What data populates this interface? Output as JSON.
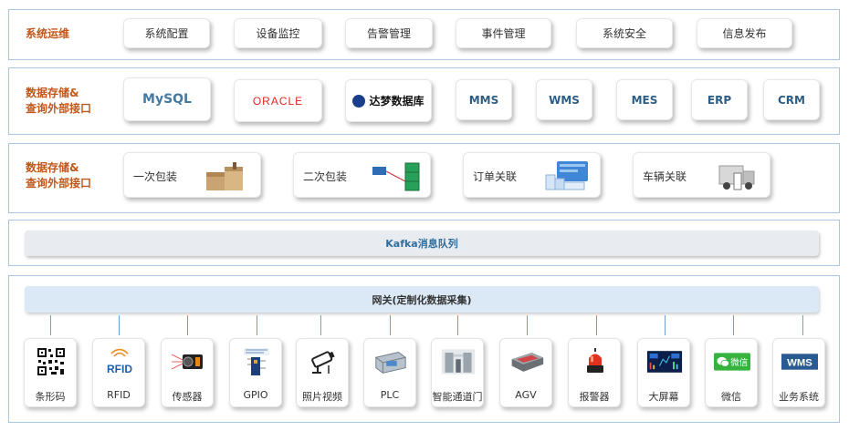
{
  "row1": {
    "label": "系统运维",
    "items": [
      "系统配置",
      "设备监控",
      "告警管理",
      "事件管理",
      "系统安全",
      "信息发布"
    ]
  },
  "row2": {
    "label": "数据存储&\n查询外部接口",
    "logos": {
      "mysql": "MySQL",
      "oracle": "ORACLE",
      "dameng": "达梦数据库"
    },
    "systems": [
      "MMS",
      "WMS",
      "MES",
      "ERP",
      "CRM"
    ]
  },
  "row3": {
    "label": "数据存储&\n查询外部接口",
    "items": [
      "一次包装",
      "二次包装",
      "订单关联",
      "车辆关联"
    ]
  },
  "kafka": {
    "label": "Kafka消息队列"
  },
  "gateway": {
    "label": "网关(定制化数据采集)"
  },
  "devices": [
    {
      "label": "条形码",
      "icon": "qr-code-icon"
    },
    {
      "label": "RFID",
      "icon": "rfid-icon"
    },
    {
      "label": "传感器",
      "icon": "sensor-icon"
    },
    {
      "label": "GPIO",
      "icon": "gpio-board-icon"
    },
    {
      "label": "照片视频",
      "icon": "camera-icon"
    },
    {
      "label": "PLC",
      "icon": "plc-icon"
    },
    {
      "label": "智能通道门",
      "icon": "gate-icon"
    },
    {
      "label": "AGV",
      "icon": "agv-icon"
    },
    {
      "label": "报警器",
      "icon": "alarm-icon"
    },
    {
      "label": "大屏幕",
      "icon": "big-screen-icon"
    },
    {
      "label": "微信",
      "icon": "wechat-icon"
    },
    {
      "label": "业务系统",
      "icon": "wms-icon"
    }
  ],
  "device_texts": {
    "rfid": "RFID",
    "wechat": "微信",
    "wms": "WMS"
  },
  "colors": {
    "label": "#c0571b",
    "border": "#a9c6e3",
    "bar": "#dbe9f6",
    "bar_text": "#2f6e9e",
    "line": "#6fa0d1"
  }
}
